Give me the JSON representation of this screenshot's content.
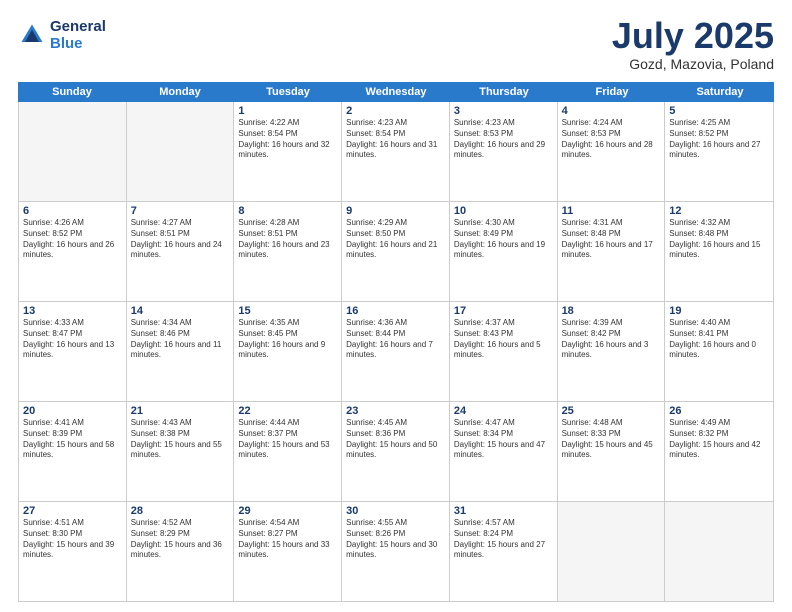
{
  "logo": {
    "line1": "General",
    "line2": "Blue"
  },
  "title": "July 2025",
  "location": "Gozd, Mazovia, Poland",
  "header_days": [
    "Sunday",
    "Monday",
    "Tuesday",
    "Wednesday",
    "Thursday",
    "Friday",
    "Saturday"
  ],
  "rows": [
    [
      {
        "day": "",
        "sunrise": "",
        "sunset": "",
        "daylight": "",
        "empty": true
      },
      {
        "day": "",
        "sunrise": "",
        "sunset": "",
        "daylight": "",
        "empty": true
      },
      {
        "day": "1",
        "sunrise": "Sunrise: 4:22 AM",
        "sunset": "Sunset: 8:54 PM",
        "daylight": "Daylight: 16 hours and 32 minutes."
      },
      {
        "day": "2",
        "sunrise": "Sunrise: 4:23 AM",
        "sunset": "Sunset: 8:54 PM",
        "daylight": "Daylight: 16 hours and 31 minutes."
      },
      {
        "day": "3",
        "sunrise": "Sunrise: 4:23 AM",
        "sunset": "Sunset: 8:53 PM",
        "daylight": "Daylight: 16 hours and 29 minutes."
      },
      {
        "day": "4",
        "sunrise": "Sunrise: 4:24 AM",
        "sunset": "Sunset: 8:53 PM",
        "daylight": "Daylight: 16 hours and 28 minutes."
      },
      {
        "day": "5",
        "sunrise": "Sunrise: 4:25 AM",
        "sunset": "Sunset: 8:52 PM",
        "daylight": "Daylight: 16 hours and 27 minutes."
      }
    ],
    [
      {
        "day": "6",
        "sunrise": "Sunrise: 4:26 AM",
        "sunset": "Sunset: 8:52 PM",
        "daylight": "Daylight: 16 hours and 26 minutes."
      },
      {
        "day": "7",
        "sunrise": "Sunrise: 4:27 AM",
        "sunset": "Sunset: 8:51 PM",
        "daylight": "Daylight: 16 hours and 24 minutes."
      },
      {
        "day": "8",
        "sunrise": "Sunrise: 4:28 AM",
        "sunset": "Sunset: 8:51 PM",
        "daylight": "Daylight: 16 hours and 23 minutes."
      },
      {
        "day": "9",
        "sunrise": "Sunrise: 4:29 AM",
        "sunset": "Sunset: 8:50 PM",
        "daylight": "Daylight: 16 hours and 21 minutes."
      },
      {
        "day": "10",
        "sunrise": "Sunrise: 4:30 AM",
        "sunset": "Sunset: 8:49 PM",
        "daylight": "Daylight: 16 hours and 19 minutes."
      },
      {
        "day": "11",
        "sunrise": "Sunrise: 4:31 AM",
        "sunset": "Sunset: 8:48 PM",
        "daylight": "Daylight: 16 hours and 17 minutes."
      },
      {
        "day": "12",
        "sunrise": "Sunrise: 4:32 AM",
        "sunset": "Sunset: 8:48 PM",
        "daylight": "Daylight: 16 hours and 15 minutes."
      }
    ],
    [
      {
        "day": "13",
        "sunrise": "Sunrise: 4:33 AM",
        "sunset": "Sunset: 8:47 PM",
        "daylight": "Daylight: 16 hours and 13 minutes."
      },
      {
        "day": "14",
        "sunrise": "Sunrise: 4:34 AM",
        "sunset": "Sunset: 8:46 PM",
        "daylight": "Daylight: 16 hours and 11 minutes."
      },
      {
        "day": "15",
        "sunrise": "Sunrise: 4:35 AM",
        "sunset": "Sunset: 8:45 PM",
        "daylight": "Daylight: 16 hours and 9 minutes."
      },
      {
        "day": "16",
        "sunrise": "Sunrise: 4:36 AM",
        "sunset": "Sunset: 8:44 PM",
        "daylight": "Daylight: 16 hours and 7 minutes."
      },
      {
        "day": "17",
        "sunrise": "Sunrise: 4:37 AM",
        "sunset": "Sunset: 8:43 PM",
        "daylight": "Daylight: 16 hours and 5 minutes."
      },
      {
        "day": "18",
        "sunrise": "Sunrise: 4:39 AM",
        "sunset": "Sunset: 8:42 PM",
        "daylight": "Daylight: 16 hours and 3 minutes."
      },
      {
        "day": "19",
        "sunrise": "Sunrise: 4:40 AM",
        "sunset": "Sunset: 8:41 PM",
        "daylight": "Daylight: 16 hours and 0 minutes."
      }
    ],
    [
      {
        "day": "20",
        "sunrise": "Sunrise: 4:41 AM",
        "sunset": "Sunset: 8:39 PM",
        "daylight": "Daylight: 15 hours and 58 minutes."
      },
      {
        "day": "21",
        "sunrise": "Sunrise: 4:43 AM",
        "sunset": "Sunset: 8:38 PM",
        "daylight": "Daylight: 15 hours and 55 minutes."
      },
      {
        "day": "22",
        "sunrise": "Sunrise: 4:44 AM",
        "sunset": "Sunset: 8:37 PM",
        "daylight": "Daylight: 15 hours and 53 minutes."
      },
      {
        "day": "23",
        "sunrise": "Sunrise: 4:45 AM",
        "sunset": "Sunset: 8:36 PM",
        "daylight": "Daylight: 15 hours and 50 minutes."
      },
      {
        "day": "24",
        "sunrise": "Sunrise: 4:47 AM",
        "sunset": "Sunset: 8:34 PM",
        "daylight": "Daylight: 15 hours and 47 minutes."
      },
      {
        "day": "25",
        "sunrise": "Sunrise: 4:48 AM",
        "sunset": "Sunset: 8:33 PM",
        "daylight": "Daylight: 15 hours and 45 minutes."
      },
      {
        "day": "26",
        "sunrise": "Sunrise: 4:49 AM",
        "sunset": "Sunset: 8:32 PM",
        "daylight": "Daylight: 15 hours and 42 minutes."
      }
    ],
    [
      {
        "day": "27",
        "sunrise": "Sunrise: 4:51 AM",
        "sunset": "Sunset: 8:30 PM",
        "daylight": "Daylight: 15 hours and 39 minutes."
      },
      {
        "day": "28",
        "sunrise": "Sunrise: 4:52 AM",
        "sunset": "Sunset: 8:29 PM",
        "daylight": "Daylight: 15 hours and 36 minutes."
      },
      {
        "day": "29",
        "sunrise": "Sunrise: 4:54 AM",
        "sunset": "Sunset: 8:27 PM",
        "daylight": "Daylight: 15 hours and 33 minutes."
      },
      {
        "day": "30",
        "sunrise": "Sunrise: 4:55 AM",
        "sunset": "Sunset: 8:26 PM",
        "daylight": "Daylight: 15 hours and 30 minutes."
      },
      {
        "day": "31",
        "sunrise": "Sunrise: 4:57 AM",
        "sunset": "Sunset: 8:24 PM",
        "daylight": "Daylight: 15 hours and 27 minutes."
      },
      {
        "day": "",
        "sunrise": "",
        "sunset": "",
        "daylight": "",
        "empty": true
      },
      {
        "day": "",
        "sunrise": "",
        "sunset": "",
        "daylight": "",
        "empty": true
      }
    ]
  ]
}
